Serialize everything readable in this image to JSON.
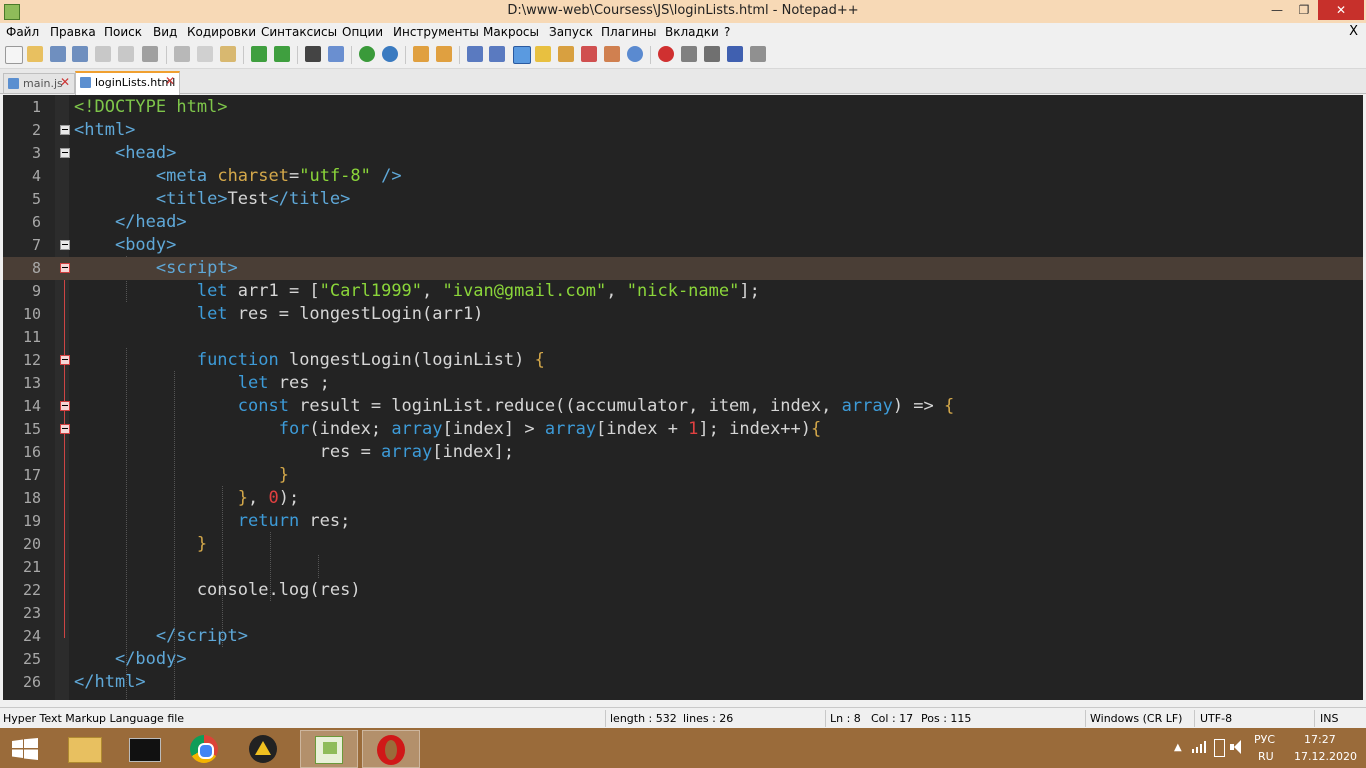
{
  "window": {
    "title": "D:\\www-web\\Coursess\\JS\\loginLists.html - Notepad++",
    "minimize": "—",
    "maximize": "❐",
    "close": "✕"
  },
  "menu": {
    "items": [
      "Файл",
      "Правка",
      "Поиск",
      "Вид",
      "Кодировки",
      "Синтаксисы",
      "Опции",
      "Инструменты",
      "Макросы",
      "Запуск",
      "Плагины",
      "Вкладки",
      "?"
    ],
    "close_doc": "X"
  },
  "tabs": [
    {
      "label": "main.js",
      "close": "✕"
    },
    {
      "label": "loginLists.html",
      "close": "✕"
    }
  ],
  "editor": {
    "line_numbers": [
      "1",
      "2",
      "3",
      "4",
      "5",
      "6",
      "7",
      "8",
      "9",
      "10",
      "11",
      "12",
      "13",
      "14",
      "15",
      "16",
      "17",
      "18",
      "19",
      "20",
      "21",
      "22",
      "23",
      "24",
      "25",
      "26"
    ],
    "current_line": 8
  },
  "status": {
    "file_type": "Hyper Text Markup Language file",
    "length": "length : 532",
    "lines": "lines : 26",
    "ln": "Ln : 8",
    "col": "Col : 17",
    "pos": "Pos : 115",
    "eol": "Windows (CR LF)",
    "encoding": "UTF-8",
    "mode": "INS"
  },
  "taskbar": {
    "lang_top": "РУС",
    "lang_bottom": "RU",
    "time": "17:27",
    "date": "17.12.2020"
  },
  "colors": {
    "title_bar": "#f7d9b6",
    "editor_bg": "#232323",
    "current_line": "#4a3e36",
    "taskbar": "#9a6b3a"
  }
}
